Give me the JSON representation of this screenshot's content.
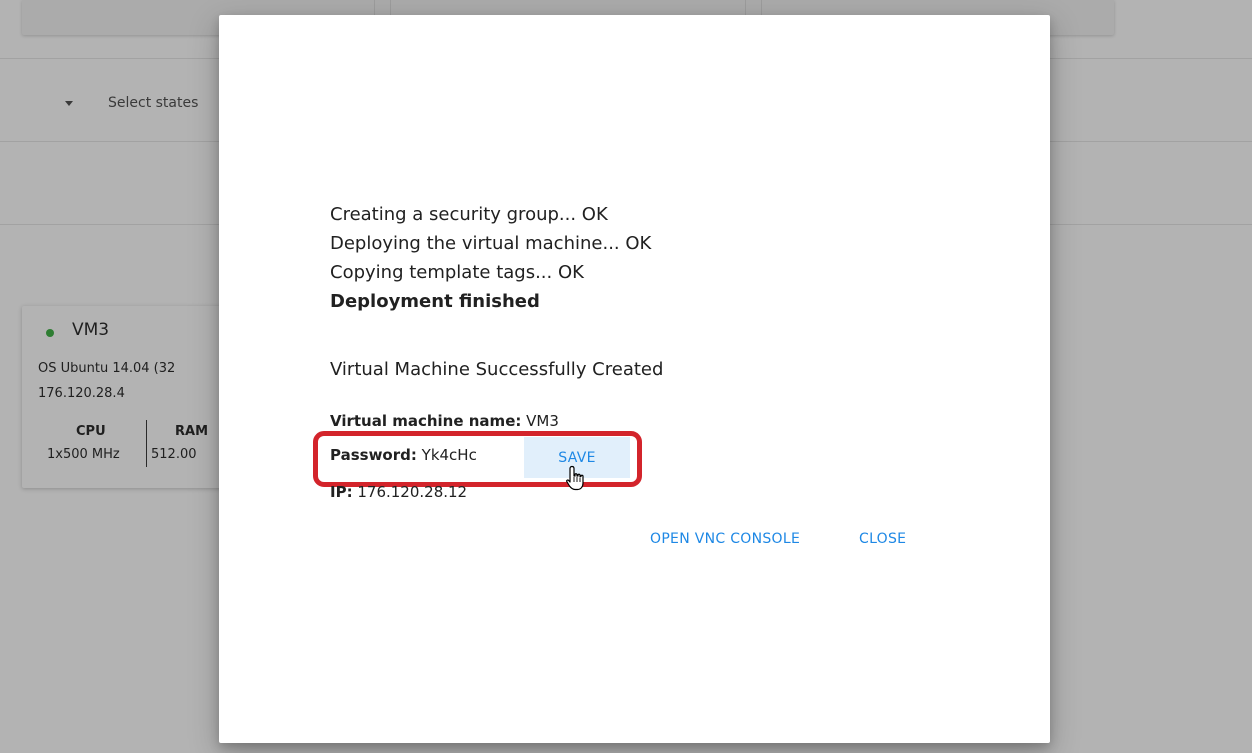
{
  "background": {
    "filter": {
      "placeholder": "Select states"
    },
    "vm_card": {
      "status_color": "#2e7d32",
      "name": "VM3",
      "os": "OS Ubuntu 14.04 (32",
      "ip": "176.120.28.4",
      "cpu_label": "CPU",
      "ram_label": "RAM",
      "cpu_value": "1x500 MHz",
      "ram_value": "512.00"
    }
  },
  "dialog": {
    "log_lines": [
      "Creating a security group... OK",
      "Deploying the virtual machine... OK",
      "Copying template tags... OK"
    ],
    "finished": "Deployment finished",
    "success_message": "Virtual Machine Successfully Created",
    "vm_name_label": "Virtual machine name:",
    "vm_name_value": "VM3",
    "password_label": "Password:",
    "password_value": "Yk4cHc",
    "save_label": "SAVE",
    "ip_label": "IP:",
    "ip_value": "176.120.28.12",
    "actions": {
      "vnc_label": "OPEN VNC CONSOLE",
      "close_label": "CLOSE"
    }
  },
  "colors": {
    "accent": "#1e88e5",
    "highlight": "#d3242b",
    "overlay": "#b3b3b3"
  }
}
